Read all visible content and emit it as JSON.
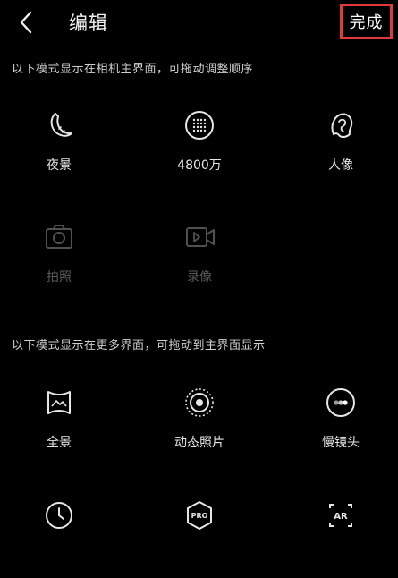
{
  "header": {
    "title": "编辑",
    "done_label": "完成"
  },
  "main_section": {
    "description": "以下模式显示在相机主界面，可拖动调整顺序",
    "modes": [
      {
        "label": "夜景",
        "icon": "moon-icon"
      },
      {
        "label": "4800万",
        "icon": "high-resolution-icon"
      },
      {
        "label": "人像",
        "icon": "portrait-icon"
      },
      {
        "label": "拍照",
        "icon": "camera-icon",
        "disabled": true
      },
      {
        "label": "录像",
        "icon": "video-icon",
        "disabled": true
      }
    ]
  },
  "more_section": {
    "description": "以下模式显示在更多界面，可拖动到主界面显示",
    "modes": [
      {
        "label": "全景",
        "icon": "panorama-icon"
      },
      {
        "label": "动态照片",
        "icon": "live-photo-icon"
      },
      {
        "label": "慢镜头",
        "icon": "slow-motion-icon"
      },
      {
        "label": "",
        "icon": "timelapse-icon"
      },
      {
        "label": "",
        "icon": "pro-mode-icon"
      },
      {
        "label": "",
        "icon": "ar-icon"
      }
    ]
  },
  "colors": {
    "background": "#000000",
    "highlight_border": "#e23a3a",
    "text": "#e6e6e6",
    "disabled_text": "#5a5a5a"
  }
}
